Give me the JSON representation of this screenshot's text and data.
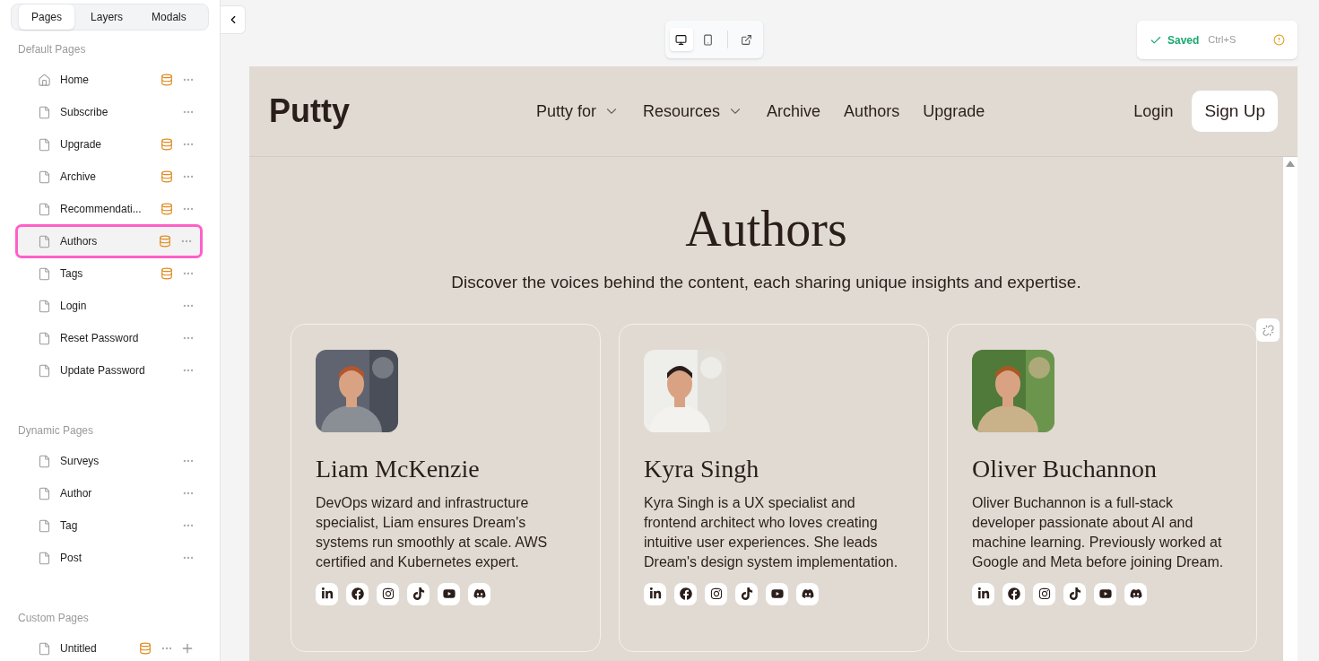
{
  "sidebar": {
    "tabs": [
      {
        "label": "Pages",
        "selected": true
      },
      {
        "label": "Layers",
        "selected": false
      },
      {
        "label": "Modals",
        "selected": false
      }
    ],
    "sections": [
      {
        "title": "Default Pages",
        "items": [
          {
            "label": "Home",
            "kind": "home",
            "data": true,
            "selected": false
          },
          {
            "label": "Subscribe",
            "kind": "page",
            "data": false,
            "selected": false
          },
          {
            "label": "Upgrade",
            "kind": "page",
            "data": true,
            "selected": false
          },
          {
            "label": "Archive",
            "kind": "page",
            "data": true,
            "selected": false
          },
          {
            "label": "Recommendati...",
            "kind": "page",
            "data": true,
            "selected": false
          },
          {
            "label": "Authors",
            "kind": "page",
            "data": true,
            "selected": true
          },
          {
            "label": "Tags",
            "kind": "page",
            "data": true,
            "selected": false
          },
          {
            "label": "Login",
            "kind": "page",
            "data": false,
            "selected": false
          },
          {
            "label": "Reset Password",
            "kind": "page",
            "data": false,
            "selected": false
          },
          {
            "label": "Update Password",
            "kind": "page",
            "data": false,
            "selected": false
          }
        ]
      },
      {
        "title": "Dynamic Pages",
        "items": [
          {
            "label": "Surveys",
            "kind": "page",
            "data": false,
            "selected": false
          },
          {
            "label": "Author",
            "kind": "page",
            "data": false,
            "selected": false
          },
          {
            "label": "Tag",
            "kind": "page",
            "data": false,
            "selected": false
          },
          {
            "label": "Post",
            "kind": "page",
            "data": false,
            "selected": false
          }
        ]
      },
      {
        "title": "Custom Pages",
        "items": [
          {
            "label": "Untitled",
            "kind": "page",
            "data": true,
            "selected": false,
            "add_button": true
          }
        ]
      }
    ]
  },
  "toolbar": {
    "devices": [
      {
        "kind": "desktop",
        "selected": true
      },
      {
        "kind": "mobile",
        "selected": false
      }
    ]
  },
  "save_status": {
    "label": "Saved",
    "shortcut": "Ctrl+S"
  },
  "site": {
    "logo": "Putty",
    "nav": [
      {
        "label": "Putty for",
        "dropdown": true
      },
      {
        "label": "Resources",
        "dropdown": true
      },
      {
        "label": "Archive"
      },
      {
        "label": "Authors"
      },
      {
        "label": "Upgrade"
      }
    ],
    "login": "Login",
    "signup": "Sign Up",
    "heading": "Authors",
    "subheading": "Discover the voices behind the content, each sharing unique insights and expertise.",
    "authors": [
      {
        "name": "Liam McKenzie",
        "bio": "DevOps wizard and infrastructure specialist, Liam ensures Dream's systems run smoothly at scale. AWS certified and Kubernetes expert."
      },
      {
        "name": "Kyra Singh",
        "bio": "Kyra Singh is a UX specialist and frontend architect who loves creating intuitive user experiences. She leads Dream's design system implementation."
      },
      {
        "name": "Oliver Buchannon",
        "bio": "Oliver Buchannon is a full-stack developer passionate about AI and machine learning. Previously worked at Google and Meta before joining Dream."
      }
    ]
  }
}
